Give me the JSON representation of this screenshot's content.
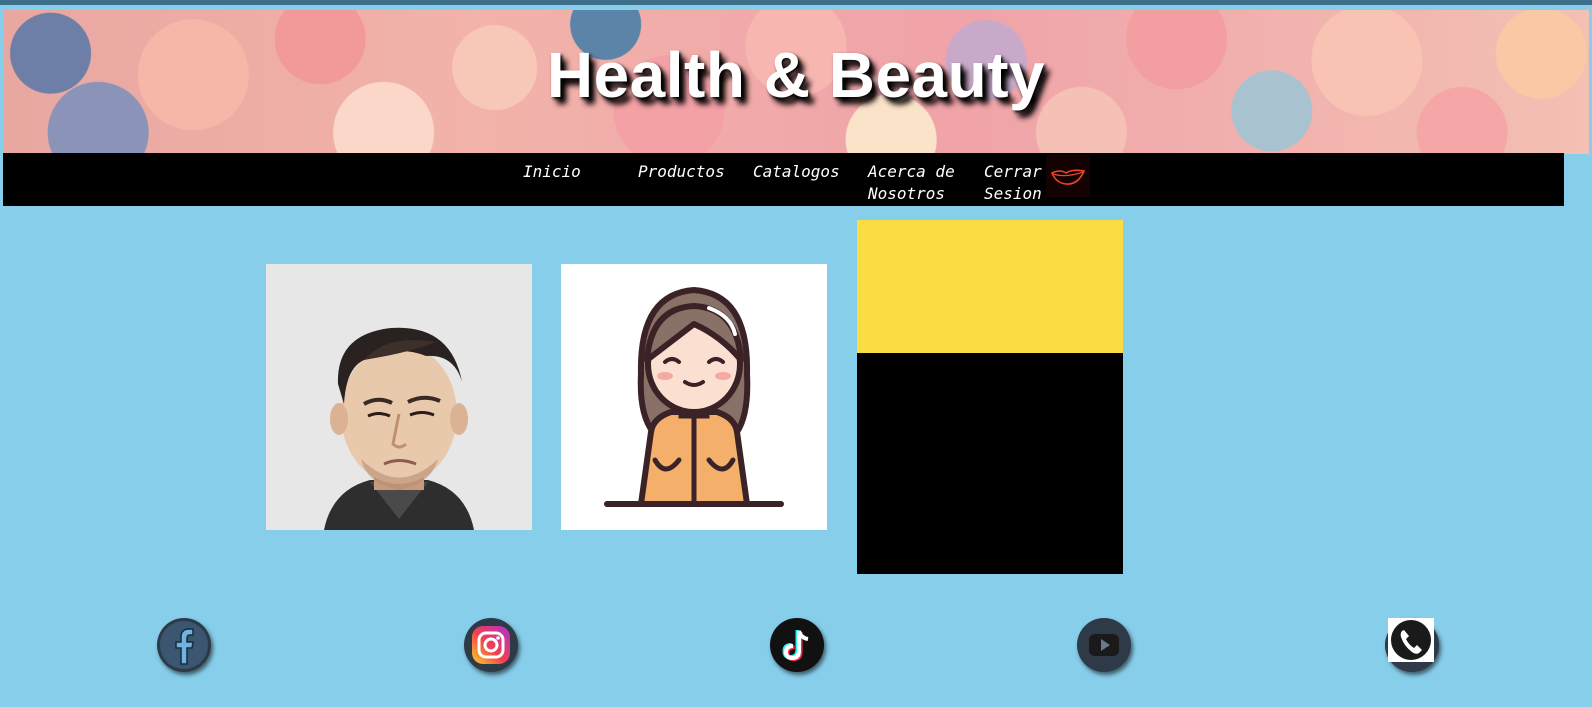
{
  "banner": {
    "title": "Health & Beauty"
  },
  "nav": {
    "items": [
      {
        "label": "Inicio"
      },
      {
        "label": "Productos"
      },
      {
        "label": "Catalogos"
      },
      {
        "label": "Acerca de Nosotros"
      },
      {
        "label": "Cerrar Sesion"
      }
    ],
    "logo_icon": "lips-icon"
  },
  "cards": [
    {
      "image": "male-avatar-3d"
    },
    {
      "image": "female-avatar-cartoon"
    },
    {
      "image": "yellow-black-placeholder"
    }
  ],
  "social": [
    {
      "icon": "facebook-icon"
    },
    {
      "icon": "instagram-icon"
    },
    {
      "icon": "tiktok-icon"
    },
    {
      "icon": "youtube-icon"
    },
    {
      "icon": "phone-icon"
    }
  ],
  "colors": {
    "background": "#87ceeb",
    "nav_background": "#000000",
    "accent_yellow": "#fbdc43"
  }
}
